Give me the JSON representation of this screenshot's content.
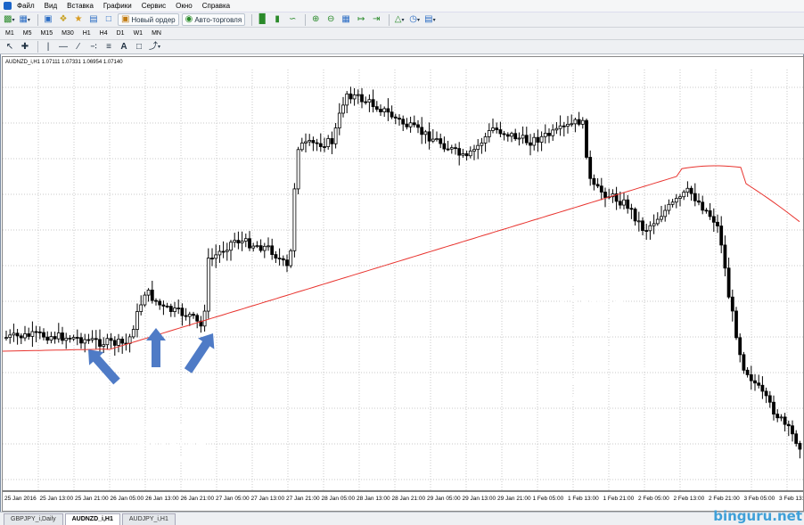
{
  "menubar": {
    "items": [
      "Файл",
      "Вид",
      "Вставка",
      "Графики",
      "Сервис",
      "Окно",
      "Справка"
    ]
  },
  "toolbar": {
    "new_order_label": "Новый ордер",
    "auto_trading_label": "Авто-торговля"
  },
  "timeframes": [
    "M1",
    "M5",
    "M15",
    "M30",
    "H1",
    "H4",
    "D1",
    "W1",
    "MN"
  ],
  "chart": {
    "title": "AUDNZD_i,H1  1.07111 1.07331 1.06954 1.07140",
    "x_labels": [
      "25 Jan 2016",
      "25 Jan 13:00",
      "25 Jan 21:00",
      "26 Jan 05:00",
      "26 Jan 13:00",
      "26 Jan 21:00",
      "27 Jan 05:00",
      "27 Jan 13:00",
      "27 Jan 21:00",
      "28 Jan 05:00",
      "28 Jan 13:00",
      "28 Jan 21:00",
      "29 Jan 05:00",
      "29 Jan 13:00",
      "29 Jan 21:00",
      "1 Feb 05:00",
      "1 Feb 13:00",
      "1 Feb 21:00",
      "2 Feb 05:00",
      "2 Feb 13:00",
      "2 Feb 21:00",
      "3 Feb 05:00",
      "3 Feb 13:"
    ]
  },
  "annotations": {
    "left_cloud": [
      "Свечки -",
      "просто метод",
      "визуализации",
      "котировок"
    ],
    "right_cloud": [
      "Валютные котировки -",
      "это цифры.",
      "Их брокеры получают",
      "от поставщиков",
      "котировок.",
      "А те, в свою очередь,",
      "от банков-участников",
      "межбанковского рынка"
    ]
  },
  "tabs": [
    "GBPJPY_i,Daily",
    "AUDNZD_i,H1",
    "AUDJPY_i,H1"
  ],
  "active_tab": "AUDNZD_i,H1",
  "watermark": "binguru.net",
  "colors": {
    "ma_line": "#e8332e",
    "cloud_fill": "#4f7bc6",
    "watermark": "#3fa0d8"
  }
}
